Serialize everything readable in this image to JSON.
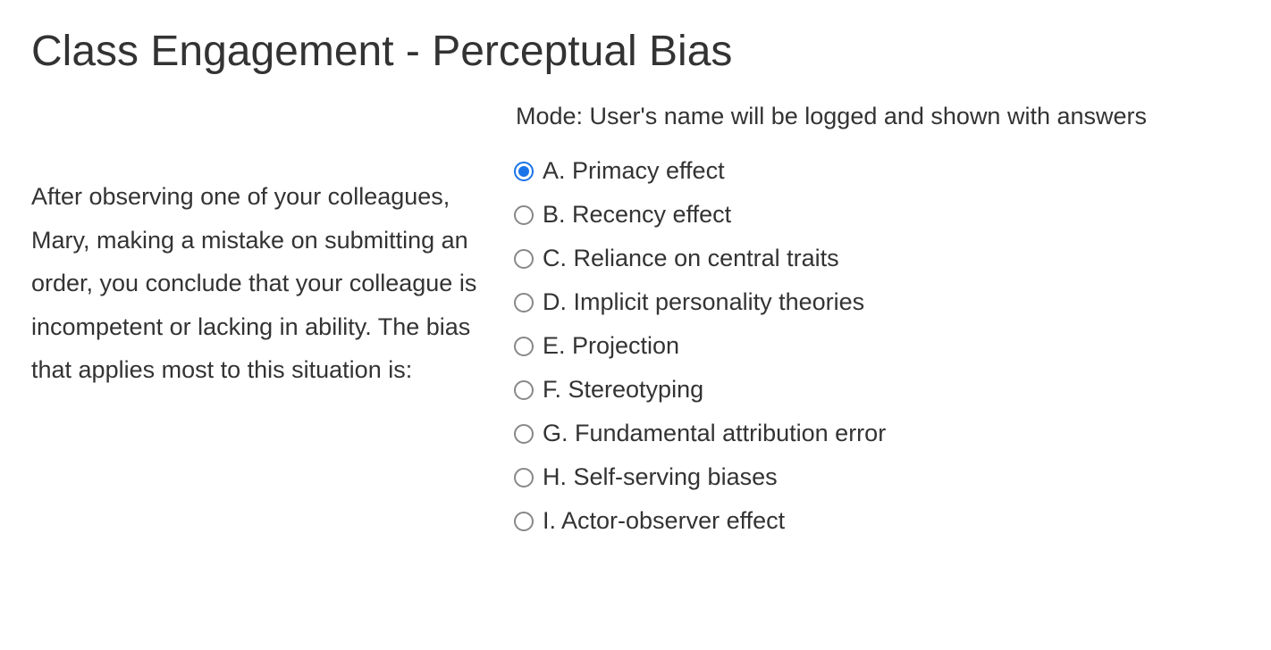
{
  "title": "Class Engagement - Perceptual Bias",
  "mode": "Mode: User's name will be logged and shown with answers",
  "question": "After observing one of your colleagues, Mary, making a mistake on submitting an order, you conclude that your colleague is incompetent or lacking in ability. The bias that applies most to this situation is:",
  "options": [
    {
      "label": "A. Primacy effect",
      "selected": true
    },
    {
      "label": "B. Recency effect",
      "selected": false
    },
    {
      "label": "C. Reliance on central traits",
      "selected": false
    },
    {
      "label": "D. Implicit personality theories",
      "selected": false
    },
    {
      "label": "E. Projection",
      "selected": false
    },
    {
      "label": "F. Stereotyping",
      "selected": false
    },
    {
      "label": "G. Fundamental attribution error",
      "selected": false
    },
    {
      "label": "H. Self-serving biases",
      "selected": false
    },
    {
      "label": "I. Actor-observer effect",
      "selected": false
    }
  ]
}
